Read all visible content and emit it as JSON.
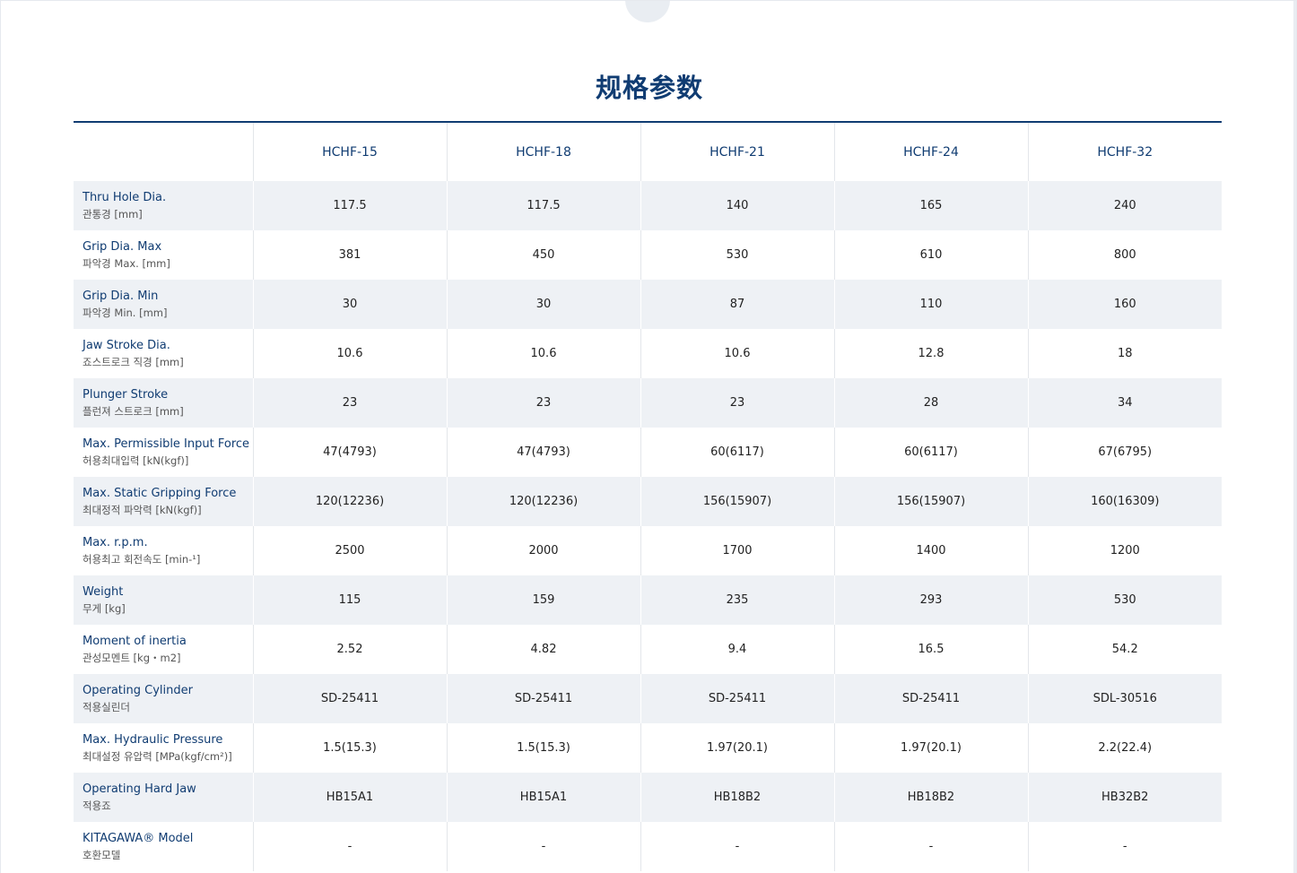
{
  "title": "规格参数",
  "table": {
    "models": [
      "HCHF-15",
      "HCHF-18",
      "HCHF-21",
      "HCHF-24",
      "HCHF-32"
    ],
    "rows": [
      {
        "label_en": "Thru Hole Dia.",
        "label_ko": "관통경 [mm]",
        "values": [
          "117.5",
          "117.5",
          "140",
          "165",
          "240"
        ]
      },
      {
        "label_en": "Grip Dia. Max",
        "label_ko": "파악경 Max. [mm]",
        "values": [
          "381",
          "450",
          "530",
          "610",
          "800"
        ]
      },
      {
        "label_en": "Grip Dia. Min",
        "label_ko": "파악경 Min. [mm]",
        "values": [
          "30",
          "30",
          "87",
          "110",
          "160"
        ]
      },
      {
        "label_en": "Jaw Stroke Dia.",
        "label_ko": "죠스트로크 직경 [mm]",
        "values": [
          "10.6",
          "10.6",
          "10.6",
          "12.8",
          "18"
        ]
      },
      {
        "label_en": "Plunger Stroke",
        "label_ko": "플런져 스트로크 [mm]",
        "values": [
          "23",
          "23",
          "23",
          "28",
          "34"
        ]
      },
      {
        "label_en": "Max. Permissible Input Force",
        "label_ko": "허용최대입력 [kN(kgf)]",
        "values": [
          "47(4793)",
          "47(4793)",
          "60(6117)",
          "60(6117)",
          "67(6795)"
        ]
      },
      {
        "label_en": "Max. Static Gripping Force",
        "label_ko": "최대정적 파악력 [kN(kgf)]",
        "values": [
          "120(12236)",
          "120(12236)",
          "156(15907)",
          "156(15907)",
          "160(16309)"
        ]
      },
      {
        "label_en": "Max. r.p.m.",
        "label_ko": "허용최고 회전속도 [min-¹]",
        "values": [
          "2500",
          "2000",
          "1700",
          "1400",
          "1200"
        ]
      },
      {
        "label_en": "Weight",
        "label_ko": "무게 [kg]",
        "values": [
          "115",
          "159",
          "235",
          "293",
          "530"
        ]
      },
      {
        "label_en": "Moment of inertia",
        "label_ko": "관성모멘트 [kg・m2]",
        "values": [
          "2.52",
          "4.82",
          "9.4",
          "16.5",
          "54.2"
        ]
      },
      {
        "label_en": "Operating Cylinder",
        "label_ko": "적용실린더",
        "values": [
          "SD-25411",
          "SD-25411",
          "SD-25411",
          "SD-25411",
          "SDL-30516"
        ]
      },
      {
        "label_en": "Max. Hydraulic Pressure",
        "label_ko": "최대설정 유압력 [MPa(kgf/cm²)]",
        "values": [
          "1.5(15.3)",
          "1.5(15.3)",
          "1.97(20.1)",
          "1.97(20.1)",
          "2.2(22.4)"
        ]
      },
      {
        "label_en": "Operating Hard Jaw",
        "label_ko": "적용죠",
        "values": [
          "HB15A1",
          "HB15A1",
          "HB18B2",
          "HB18B2",
          "HB32B2"
        ]
      },
      {
        "label_en": "KITAGAWA® Model",
        "label_ko": "호환모델",
        "values": [
          "-",
          "-",
          "-",
          "-",
          "-"
        ]
      }
    ]
  },
  "colors": {
    "accent": "#103c72",
    "row_shade": "#eef1f5"
  }
}
